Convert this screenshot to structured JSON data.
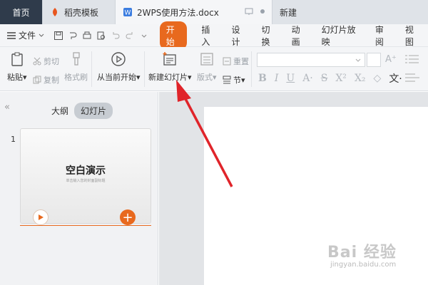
{
  "tabs": {
    "home": "首页",
    "daoke": "稻壳模板",
    "doc": "2WPS使用方法.docx",
    "new": "新建"
  },
  "menu": {
    "file": "文件",
    "items": [
      "开始",
      "插入",
      "设计",
      "切换",
      "动画",
      "幻灯片放映",
      "审阅",
      "视图"
    ],
    "active": "开始"
  },
  "ribbon": {
    "paste": "粘贴",
    "cut": "剪切",
    "copy": "复制",
    "format_painter": "格式刷",
    "from_current": "从当前开始",
    "new_slide": "新建幻灯片",
    "layout": "版式",
    "reset": "重置",
    "section": "节"
  },
  "panel": {
    "outline": "大纲",
    "slides": "幻灯片",
    "slide_number": "1",
    "thumb_title": "空白演示",
    "thumb_subtitle": "单击输入您的封面副标题"
  },
  "watermark": {
    "main": "Bai 经验",
    "sub": "jingyan.baidu.com"
  },
  "colors": {
    "accent": "#e8691e",
    "arrow": "#e0242a",
    "home_tab": "#2f3b4b"
  }
}
